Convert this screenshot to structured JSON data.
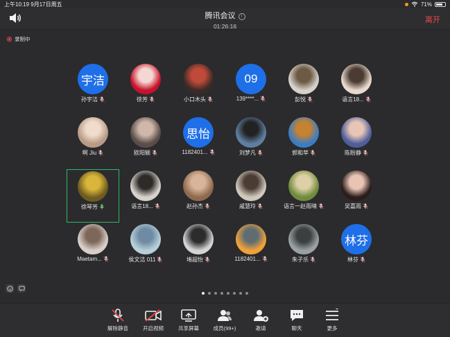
{
  "status_bar": {
    "time_date": "上午10:19  9月17日周五",
    "battery": "71%",
    "battery_level": 0.71
  },
  "header": {
    "title": "腾讯会议",
    "time": "01:26:16",
    "leave_label": "离开"
  },
  "recording_label": "录制中",
  "participants": [
    {
      "name": "孙宇洁",
      "avatar_text": "宇洁",
      "photo": false
    },
    {
      "name": "徐芳",
      "photo": true,
      "colors": [
        "#c7122b",
        "#f4d7d2"
      ]
    },
    {
      "name": "小口木头",
      "photo": true,
      "colors": [
        "#3b2a26",
        "#c04a3a"
      ]
    },
    {
      "name": "139****...",
      "avatar_text": "09",
      "photo": false
    },
    {
      "name": "彭悦",
      "photo": true,
      "colors": [
        "#d6d2ca",
        "#6c5a45"
      ]
    },
    {
      "name": "语言18...",
      "photo": true,
      "colors": [
        "#e7d9cd",
        "#4b3b33"
      ]
    },
    {
      "name": "啊 Jiu",
      "photo": true,
      "colors": [
        "#b79b86",
        "#f1dccc"
      ]
    },
    {
      "name": "欧阳颖",
      "photo": true,
      "colors": [
        "#5a4d4a",
        "#cfb8ab"
      ]
    },
    {
      "name": "1182401...",
      "avatar_text": "思怡",
      "photo": false
    },
    {
      "name": "刘梦凡",
      "photo": true,
      "colors": [
        "#5f7fa1",
        "#222"
      ]
    },
    {
      "name": "郭和苹",
      "photo": true,
      "colors": [
        "#3b7dc4",
        "#c7822f"
      ]
    },
    {
      "name": "陈盼静",
      "photo": true,
      "colors": [
        "#4f5e9b",
        "#e7c6b6"
      ]
    },
    {
      "name": "徐琴芳",
      "photo": true,
      "colors": [
        "#6e5b20",
        "#d9b63a"
      ],
      "active": true
    },
    {
      "name": "语言18...",
      "photo": true,
      "colors": [
        "#d7d3cc",
        "#2e2a28"
      ]
    },
    {
      "name": "赵孙杰",
      "photo": true,
      "colors": [
        "#8f6a4f",
        "#d8b59a"
      ]
    },
    {
      "name": "戚慧玲",
      "photo": true,
      "colors": [
        "#cfc8bb",
        "#4b3c33"
      ]
    },
    {
      "name": "语言一赵雨晴",
      "photo": true,
      "colors": [
        "#6f8b3c",
        "#ddd0a6"
      ]
    },
    {
      "name": "吴嘉雨",
      "photo": true,
      "colors": [
        "#2a1d1a",
        "#e9c4b4"
      ]
    },
    {
      "name": "Maetam...",
      "photo": true,
      "colors": [
        "#d9cfc8",
        "#7e675a"
      ]
    },
    {
      "name": "侯文洁 011",
      "photo": true,
      "colors": [
        "#b7cfd9",
        "#6e8ba3"
      ]
    },
    {
      "name": "堵超怡",
      "photo": true,
      "colors": [
        "#d4d4d4",
        "#2c2c2c"
      ]
    },
    {
      "name": "1182401...",
      "photo": true,
      "colors": [
        "#f1a13a",
        "#5f6d73"
      ]
    },
    {
      "name": "朱子乐",
      "photo": true,
      "colors": [
        "#9aa1a2",
        "#3c3f40"
      ]
    },
    {
      "name": "林芬",
      "avatar_text": "林芬",
      "photo": false
    }
  ],
  "pager": {
    "count": 8,
    "current": 0
  },
  "toolbar": [
    {
      "label": "解除静音",
      "icon": "mic-muted-icon"
    },
    {
      "label": "开启视频",
      "icon": "video-off-icon"
    },
    {
      "label": "共享屏幕",
      "icon": "share-screen-icon"
    },
    {
      "label": "成员(99+)",
      "icon": "members-icon"
    },
    {
      "label": "邀请",
      "icon": "invite-icon"
    },
    {
      "label": "聊天",
      "icon": "chat-icon"
    },
    {
      "label": "更多",
      "icon": "more-icon"
    }
  ]
}
